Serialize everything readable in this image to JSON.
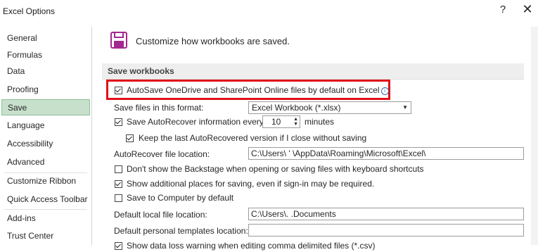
{
  "window": {
    "title": "Excel Options",
    "help_label": "?",
    "close_label": "✕"
  },
  "sidebar": {
    "items": [
      {
        "label": "General"
      },
      {
        "label": "Formulas"
      },
      {
        "label": "Data"
      },
      {
        "label": "Proofing"
      },
      {
        "label": "Save"
      },
      {
        "label": "Language"
      },
      {
        "label": "Accessibility"
      },
      {
        "label": "Advanced"
      },
      {
        "label": "Customize Ribbon"
      },
      {
        "label": "Quick Access Toolbar"
      },
      {
        "label": "Add-ins"
      },
      {
        "label": "Trust Center"
      }
    ],
    "selected": "Save"
  },
  "header": {
    "text": "Customize how workbooks are saved.",
    "icon": "floppy-disk-icon",
    "icon_color": "#a3288f"
  },
  "section": {
    "title": "Save workbooks"
  },
  "options": {
    "autosave_label": "AutoSave OneDrive and SharePoint Online files by default on Excel",
    "autosave_checked": true,
    "format_label": "Save files in this format:",
    "format_value": "Excel Workbook (*.xlsx)",
    "autorecover_label": "Save AutoRecover information every",
    "autorecover_checked": true,
    "autorecover_minutes": "10",
    "minutes_label": "minutes",
    "keep_last_label": "Keep the last AutoRecovered version if I close without saving",
    "keep_last_checked": true,
    "autorecover_location_label": "AutoRecover file location:",
    "autorecover_location_value": "C:\\Users\\      '      \\AppData\\Roaming\\Microsoft\\Excel\\",
    "backstage_label": "Don't show the Backstage when opening or saving files with keyboard shortcuts",
    "backstage_checked": false,
    "additional_places_label": "Show additional places for saving, even if sign-in may be required.",
    "additional_places_checked": true,
    "save_computer_label": "Save to Computer by default",
    "save_computer_checked": false,
    "default_local_label": "Default local file location:",
    "default_local_value": "C:\\Users\\.              .Documents",
    "default_templates_label": "Default personal templates location:",
    "default_templates_value": "",
    "data_loss_label": "Show data loss warning when editing comma delimited files (*.csv)",
    "data_loss_checked": true
  },
  "colors": {
    "highlight": "#e0101a",
    "selected_nav": "#c7e0cc"
  }
}
